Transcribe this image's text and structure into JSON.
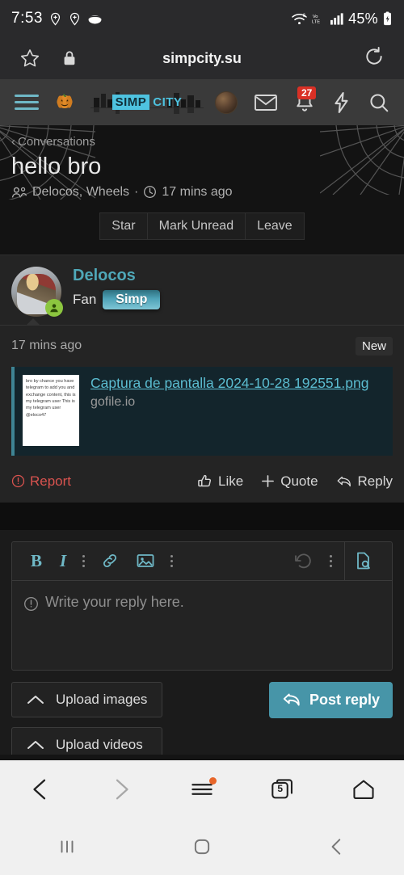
{
  "status_bar": {
    "time": "7:53",
    "battery": "45%",
    "network_label": "LTE",
    "volte_label": "Vo",
    "wifi_gen": "6",
    "icons": [
      "location-pin-add-icon",
      "location-pin-add-icon",
      "disc-icon",
      "wifi-icon",
      "volte-icon",
      "signal-bars-icon",
      "battery-charging-icon"
    ]
  },
  "browser": {
    "url_title": "simpcity.su",
    "bookmark_icon": "star-icon",
    "lock_icon": "lock-icon",
    "reload_icon": "reload-icon",
    "bottom_bar": {
      "back": "back-chevron",
      "forward": "forward-chevron",
      "menu": "menu-lines",
      "tab_count": "5",
      "home": "home-icon"
    }
  },
  "forum_nav": {
    "menu_icon": "hamburger-icon",
    "pumpkin_icon": "pumpkin-icon",
    "logo_primary": "SIMP",
    "logo_secondary": "CITY",
    "avatar_icon": "user-avatar",
    "inbox_icon": "envelope-icon",
    "alerts_icon": "bell-icon",
    "alerts_count": "27",
    "bolt_icon": "lightning-bolt-icon",
    "search_icon": "search-icon"
  },
  "thread": {
    "breadcrumb_back_icon": "chevron-left-icon",
    "breadcrumb": "Conversations",
    "title": "hello bro",
    "participants_icon": "people-icon",
    "participants": "Delocos, Wheels",
    "separator": "·",
    "clock_icon": "clock-icon",
    "time": "17 mins ago",
    "actions": [
      {
        "label": "Star",
        "name": "star-button"
      },
      {
        "label": "Mark Unread",
        "name": "mark-unread-button"
      },
      {
        "label": "Leave",
        "name": "leave-button"
      }
    ]
  },
  "post": {
    "author": "Delocos",
    "user_title": "Fan",
    "user_badge": "Simp",
    "online_icon": "online-status-icon",
    "time": "17 mins ago",
    "new_label": "New",
    "link_card": {
      "thumbnail_text": "bro by chance you have telegram to add you and exchange content, this is my telegram user This is my telegram user @eloco47",
      "title": "Captura de pantalla 2024-10-28 192551.png",
      "host": "gofile.io"
    },
    "actions": {
      "report": "Report",
      "report_icon": "warning-circle-icon",
      "like": "Like",
      "like_icon": "thumbs-up-icon",
      "quote": "Quote",
      "quote_icon": "plus-icon",
      "reply": "Reply",
      "reply_icon": "reply-arrow-icon"
    }
  },
  "editor": {
    "toolbar": [
      {
        "label": "B",
        "name": "bold-button"
      },
      {
        "label": "I",
        "name": "italic-button"
      },
      {
        "label": "",
        "name": "more-options-icon"
      },
      {
        "label": "",
        "name": "link-icon"
      },
      {
        "label": "",
        "name": "image-icon"
      },
      {
        "label": "",
        "name": "more-options-icon"
      },
      {
        "label": "",
        "name": "undo-icon"
      },
      {
        "label": "",
        "name": "more-options-icon"
      },
      {
        "label": "",
        "name": "preview-document-icon"
      }
    ],
    "placeholder": "Write your reply here.",
    "placeholder_icon": "warning-circle-icon",
    "upload_images": "Upload images",
    "upload_videos": "Upload videos",
    "upload_icon": "chevron-up-icon",
    "post_reply": "Post reply",
    "post_reply_icon": "reply-arrow-icon"
  },
  "android_nav": {
    "recents": "recents-icon",
    "home": "home-circle-icon",
    "back": "back-chevron-icon"
  },
  "colors": {
    "accent": "#4fa8b8",
    "link": "#5bbcd0",
    "badge_red": "#d93025",
    "report_red": "#d9534f",
    "online_green": "#8cc63f",
    "post_reply_bg": "#4795a8",
    "orange_dot": "#e8662a"
  }
}
